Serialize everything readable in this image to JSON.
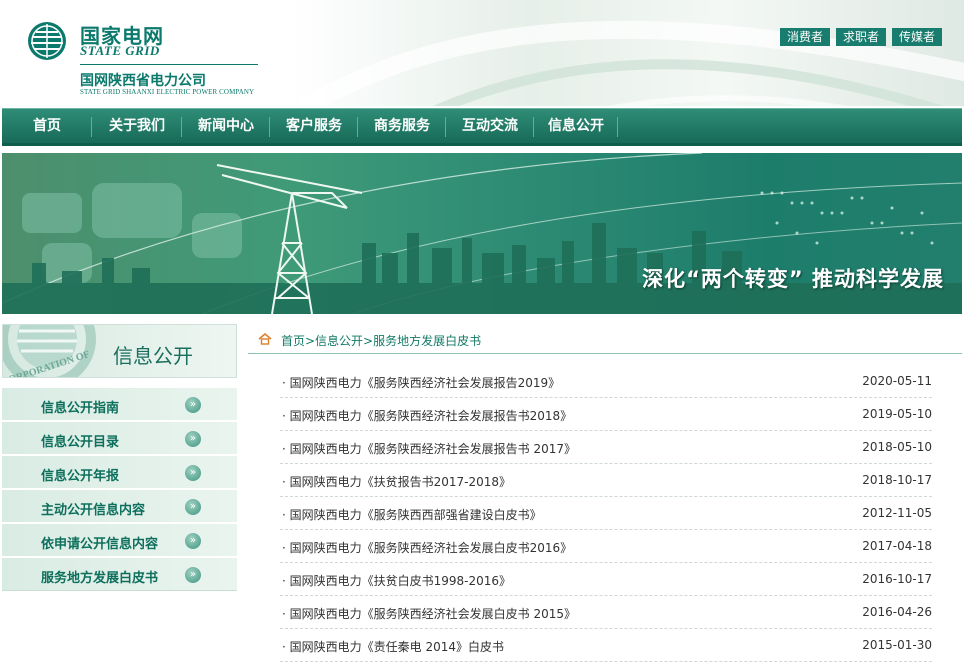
{
  "header": {
    "logo_cn": "国家电网",
    "logo_en": "STATE GRID",
    "company_cn": "国网陕西省电力公司",
    "company_en": "STATE GRID SHAANXI ELECTRIC POWER COMPANY",
    "top_links": [
      "消费者",
      "求职者",
      "传媒者"
    ]
  },
  "nav": {
    "items": [
      "首页",
      "关于我们",
      "新闻中心",
      "客户服务",
      "商务服务",
      "互动交流",
      "信息公开"
    ]
  },
  "banner": {
    "slogan": "深化“两个转变” 推动科学发展"
  },
  "sidebar": {
    "title": "信息公开",
    "seal_text": "CORPORATION OF",
    "items": [
      "信息公开指南",
      "信息公开目录",
      "信息公开年报",
      "主动公开信息内容",
      "依申请公开信息内容",
      "服务地方发展白皮书"
    ],
    "arrow": "»"
  },
  "breadcrumb": {
    "text": "首页>信息公开>服务地方发展白皮书"
  },
  "list": [
    {
      "title": "· 国网陕西电力《服务陕西经济社会发展报告2019》",
      "date": "2020-05-11"
    },
    {
      "title": "· 国网陕西电力《服务陕西经济社会发展报告书2018》",
      "date": "2019-05-10"
    },
    {
      "title": "· 国网陕西电力《服务陕西经济社会发展报告书 2017》",
      "date": "2018-05-10"
    },
    {
      "title": "· 国网陕西电力《扶贫报告书2017-2018》",
      "date": "2018-10-17"
    },
    {
      "title": "· 国网陕西电力《服务陕西西部强省建设白皮书》",
      "date": "2012-11-05"
    },
    {
      "title": "· 国网陕西电力《服务陕西经济社会发展白皮书2016》",
      "date": "2017-04-18"
    },
    {
      "title": "· 国网陕西电力《扶贫白皮书1998-2016》",
      "date": "2016-10-17"
    },
    {
      "title": "· 国网陕西电力《服务陕西经济社会发展白皮书 2015》",
      "date": "2016-04-26"
    },
    {
      "title": "· 国网陕西电力《责任秦电 2014》白皮书",
      "date": "2015-01-30"
    }
  ]
}
